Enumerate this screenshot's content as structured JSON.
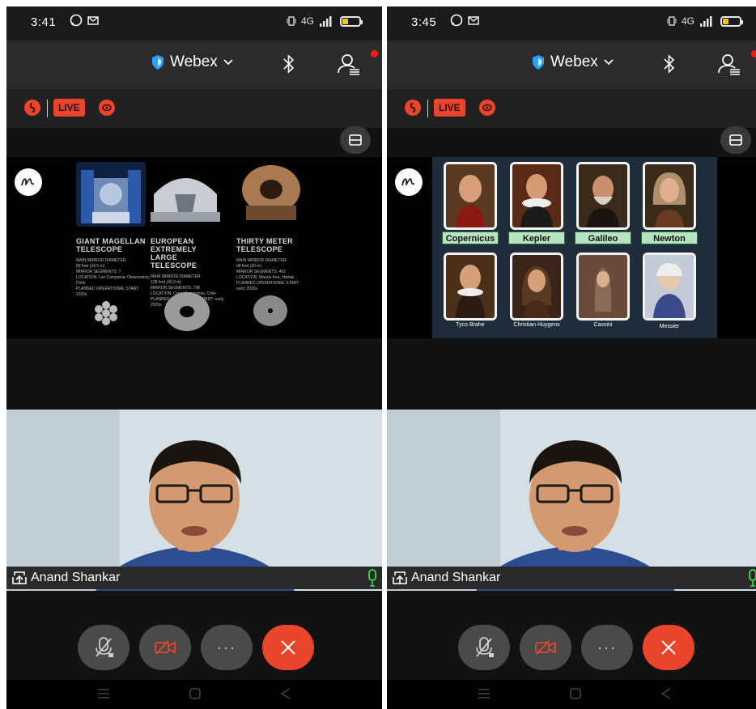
{
  "colors": {
    "accent_red": "#e8452c",
    "webex_blue": "#2aa0ff",
    "mic_green": "#3ddc52",
    "notify_red": "#ff1a1a"
  },
  "icons": {
    "status": [
      "whatsapp-icon",
      "mail-icon",
      "vibrate-icon",
      "signal-icon",
      "battery-icon"
    ],
    "toolbar": [
      "webex-shield-icon",
      "chevron-down-icon",
      "bluetooth-icon",
      "participants-icon"
    ],
    "controls": [
      "mic-muted-icon",
      "camera-off-icon",
      "more-icon",
      "end-call-icon"
    ],
    "nav": [
      "menu-icon",
      "home-icon",
      "back-icon"
    ]
  },
  "phones": [
    {
      "time": "3:41",
      "network": "4G",
      "app_title": "Webex",
      "live_label": "LIVE",
      "participant_name": "Anand Shankar",
      "shared": {
        "telescopes": [
          {
            "name": "GIANT MAGELLAN TELESCOPE",
            "details": [
              "MAIN MIRROR DIAMETER:",
              "80 feet (24.5 m)",
              "MIRROR SEGMENTS: 7",
              "LOCATION: Las Campanas Observatory, Chile",
              "PLANNED OPERATIONAL START:",
              "2020s"
            ]
          },
          {
            "name": "EUROPEAN EXTREMELY LARGE TELESCOPE",
            "details": [
              "MAIN MIRROR DIAMETER:",
              "128 feet (39.3 m)",
              "MIRROR SEGMENTS: 798",
              "LOCATION: Cerro Armazones, Chile",
              "PLANNED OPERATIONAL START: early 2020s"
            ]
          },
          {
            "name": "THIRTY METER TELESCOPE",
            "details": [
              "MAIN MIRROR DIAMETER:",
              "98 feet (30 m)",
              "MIRROR SEGMENTS: 492",
              "LOCATION: Mauna Kea, Hawaii",
              "PLANNED OPERATIONAL START:",
              "early 2020s"
            ]
          }
        ]
      }
    },
    {
      "time": "3:45",
      "network": "4G",
      "app_title": "Webex",
      "live_label": "LIVE",
      "participant_name": "Anand Shankar",
      "shared": {
        "astronomers_top": [
          "Copernicus",
          "Kepler",
          "Galileo",
          "Newton"
        ],
        "astronomers_bottom": [
          "Tyco Brahe",
          "Christian Huygens",
          "Cassini",
          "Messier"
        ]
      }
    }
  ]
}
